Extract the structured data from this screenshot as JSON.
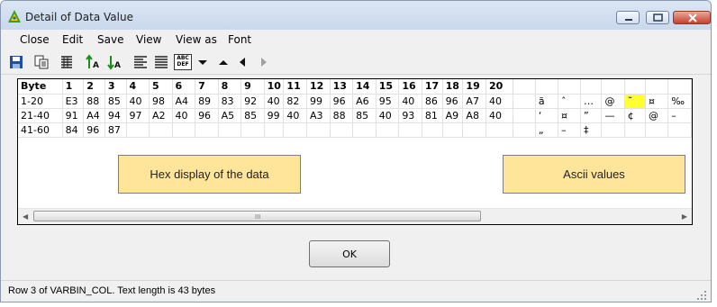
{
  "window": {
    "title": "Detail of Data Value",
    "colors": {
      "title_bar": "#c9d8ec",
      "note_fill": "#ffe599",
      "highlight": "#ffff33"
    }
  },
  "menu": [
    "Close",
    "Edit",
    "Save",
    "View",
    "View as",
    "Font"
  ],
  "toolbar": {
    "icons": [
      "save-icon",
      "copy-icon",
      "columns-icon",
      "sort-ascending-icon",
      "sort-descending-icon",
      "align-left-icon",
      "align-justify-icon",
      "abc-def-icon",
      "dropdown-triangle-icon",
      "up-triangle-icon",
      "left-triangle-icon",
      "right-triangle-icon"
    ],
    "abc_top": "ABC",
    "abc_bottom": "DEF"
  },
  "grid": {
    "header": [
      "Byte",
      "1",
      "2",
      "3",
      "4",
      "5",
      "6",
      "7",
      "8",
      "9",
      "10",
      "11",
      "12",
      "13",
      "14",
      "15",
      "16",
      "17",
      "18",
      "19",
      "20"
    ],
    "rows": [
      {
        "label": "1-20",
        "hex": [
          "E3",
          "88",
          "85",
          "40",
          "98",
          "A4",
          "89",
          "83",
          "92",
          "40",
          "82",
          "99",
          "96",
          "A6",
          "95",
          "40",
          "86",
          "96",
          "A7",
          "40"
        ],
        "ascii": [
          "ã",
          "ˆ",
          "…",
          "@",
          "˜",
          "¤",
          "‰"
        ]
      },
      {
        "label": "21-40",
        "hex": [
          "91",
          "A4",
          "94",
          "97",
          "A2",
          "40",
          "96",
          "A5",
          "85",
          "99",
          "40",
          "A3",
          "88",
          "85",
          "40",
          "93",
          "81",
          "A9",
          "A8",
          "40"
        ],
        "ascii": [
          "‘",
          "¤",
          "”",
          "—",
          "¢",
          "@",
          "–"
        ]
      },
      {
        "label": "41-60",
        "hex": [
          "84",
          "96",
          "87",
          "",
          "",
          "",
          "",
          "",
          "",
          "",
          "",
          "",
          "",
          "",
          "",
          "",
          "",
          "",
          "",
          ""
        ],
        "ascii": [
          "„",
          "–",
          "‡",
          "",
          "",
          "",
          ""
        ]
      }
    ]
  },
  "notes": {
    "hex": "Hex display of the data",
    "ascii": "Ascii values"
  },
  "scroll_grip": "III",
  "ok_label": "OK",
  "status": "Row 3 of VARBIN_COL. Text length is 43 bytes"
}
